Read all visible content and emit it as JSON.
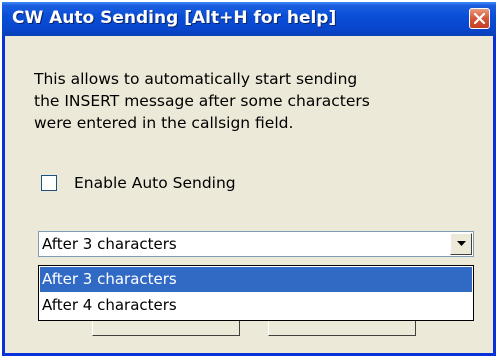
{
  "window": {
    "title": "CW Auto Sending [Alt+H for help]",
    "title_color": "#ffffff",
    "titlebar_color": "#0a4fd8",
    "close_button_icon": "close-icon"
  },
  "description": {
    "lines": [
      "This allows to automatically start sending",
      "the INSERT message after some characters",
      "were entered in the callsign field."
    ]
  },
  "enable_checkbox": {
    "label": "Enable Auto Sending",
    "checked": false
  },
  "combo": {
    "selected": "After 3 characters",
    "arrow_icon": "chevron-down-icon"
  },
  "dropdown": {
    "options": [
      {
        "label": "After 3 characters",
        "selected": true
      },
      {
        "label": "After 4 characters",
        "selected": false
      }
    ],
    "highlight_color": "#316ac5"
  }
}
